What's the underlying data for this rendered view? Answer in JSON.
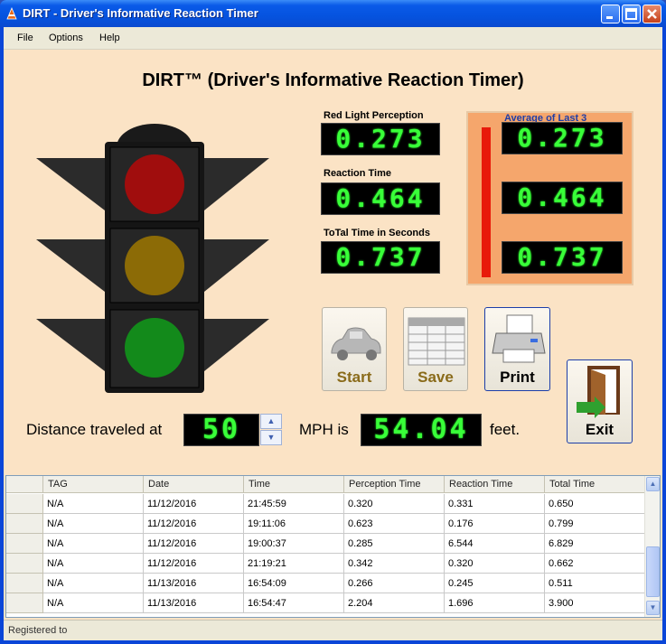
{
  "window": {
    "title": "DIRT - Driver's Informative Reaction Timer"
  },
  "menu": {
    "file": "File",
    "options": "Options",
    "help": "Help"
  },
  "heading": "DIRT™ (Driver's Informative Reaction Timer)",
  "timers": {
    "perception_label": "Red Light Perception",
    "perception_value": "0.273",
    "reaction_label": "Reaction Time",
    "reaction_value": "0.464",
    "total_label": "ToTal Time in Seconds",
    "total_value": "0.737"
  },
  "average": {
    "title": "Average of Last 3",
    "perception": "0.273",
    "reaction": "0.464",
    "total": "0.737"
  },
  "buttons": {
    "start": "Start",
    "save": "Save",
    "print": "Print",
    "exit": "Exit"
  },
  "distance": {
    "prefix": "Distance traveled at",
    "speed": "50",
    "mph_label": "MPH is",
    "feet": "54.04",
    "suffix": "feet."
  },
  "table": {
    "columns": [
      "TAG",
      "Date",
      "Time",
      "Perception Time",
      "Reaction Time",
      "Total Time"
    ],
    "rows": [
      [
        "N/A",
        "11/12/2016",
        "21:45:59",
        "0.320",
        "0.331",
        "0.650"
      ],
      [
        "N/A",
        "11/12/2016",
        "19:11:06",
        "0.623",
        "0.176",
        "0.799"
      ],
      [
        "N/A",
        "11/12/2016",
        "19:00:37",
        "0.285",
        "6.544",
        "6.829"
      ],
      [
        "N/A",
        "11/12/2016",
        "21:19:21",
        "0.342",
        "0.320",
        "0.662"
      ],
      [
        "N/A",
        "11/13/2016",
        "16:54:09",
        "0.266",
        "0.245",
        "0.511"
      ],
      [
        "N/A",
        "11/13/2016",
        "16:54:47",
        "2.204",
        "1.696",
        "3.900"
      ]
    ]
  },
  "status": {
    "text": "Registered to"
  },
  "colors": {
    "lcd_green": "#39ff39",
    "panel": "#f5a66c",
    "background": "#fbe3c5",
    "red_light": "#a00d0d",
    "yellow_light": "#8c6b06",
    "green_light": "#138a1b"
  },
  "icons": {
    "app": "traffic-cone-icon",
    "minimize": "minimize-icon",
    "maximize": "maximize-icon",
    "close": "close-icon",
    "start": "car-icon",
    "save": "table-icon",
    "print": "printer-icon",
    "exit": "door-exit-icon",
    "spin_up": "chevron-up-icon",
    "spin_down": "chevron-down-icon"
  }
}
